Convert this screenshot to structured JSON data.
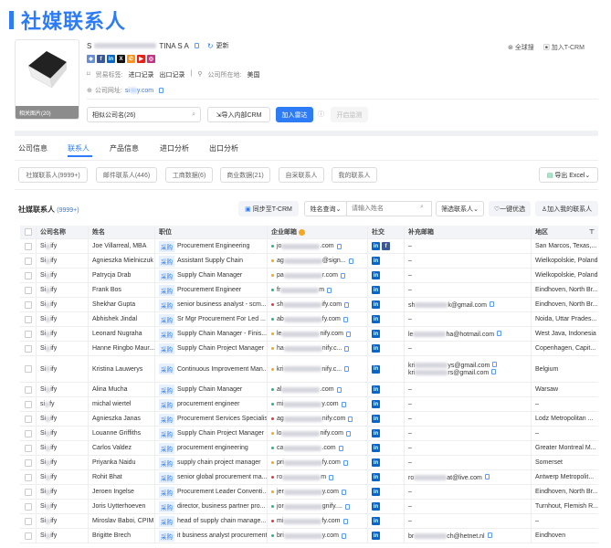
{
  "page_title": "社媒联系人",
  "company": {
    "name_prefix": "S",
    "name_suffix": "TINA S A",
    "update_label": "更新",
    "photos_label": "相关图片(20)",
    "trade_tag_label": "贸易标签:",
    "trade_tags": [
      "进口记录",
      "出口记录"
    ],
    "location_label": "公司所在地:",
    "location": "美国",
    "website_label": "公司网址:",
    "website_prefix": "si",
    "website_suffix": "y.com",
    "global_search": "全球搜",
    "add_tcrm": "加入T-CRM",
    "similar": "相似公司名(26)",
    "import_crm": "导入内部CRM",
    "add_radar": "加入雷达",
    "monitor": "开启监测"
  },
  "tabs": [
    {
      "label": "公司信息"
    },
    {
      "label": "联系人"
    },
    {
      "label": "产品信息"
    },
    {
      "label": "进口分析"
    },
    {
      "label": "出口分析"
    }
  ],
  "subtabs": [
    "社媒联系人(9999+)",
    "邮件联系人(446)",
    "工商数据(6)",
    "商业数据(21)",
    "自采联系人",
    "我的联系人"
  ],
  "export_label": "导出 Excel",
  "section": {
    "title": "社媒联系人",
    "count": "(9999+)",
    "sync": "同步至T-CRM",
    "name_query": "姓名查询",
    "search_placeholder": "请输入姓名",
    "filter": "筛选联系人",
    "optimize": "一键优选",
    "add_mine": "加入我的联系人"
  },
  "colors": {
    "accent": "#2d7cf6",
    "green": "#2bb673",
    "orange": "#f5a623",
    "red": "#e5393a"
  },
  "columns": [
    "公司名称",
    "姓名",
    "职位",
    "企业邮箱",
    "社交",
    "补充邮箱",
    "地区"
  ],
  "tag": "采购",
  "rows": [
    {
      "company": "Si ify",
      "name": "Joe Villarreal, MBA",
      "position": "Procurement Engineering",
      "ep": "jo",
      "es": ".com",
      "dot": "green",
      "fb": true,
      "supp": [],
      "region": "San Marcos, Texas,..."
    },
    {
      "company": "Si ify",
      "name": "Agnieszka Mielniczuk",
      "position": "Assistant Supply Chain",
      "ep": "ag",
      "es": "@sign...",
      "dot": "orange",
      "supp": [],
      "region": "Wielkopolskie, Poland"
    },
    {
      "company": "Si ify",
      "name": "Patrycja Drab",
      "position": "Supply Chain Manager",
      "ep": "pa",
      "es": "r.com",
      "dot": "orange",
      "supp": [],
      "region": "Wielkopolskie, Poland"
    },
    {
      "company": "Si ify",
      "name": "Frank Bos",
      "position": "Procurement Engineer",
      "ep": "fr",
      "es": "m",
      "dot": "green",
      "supp": [],
      "region": "Eindhoven, North Br..."
    },
    {
      "company": "Si ify",
      "name": "Shekhar Gupta",
      "position": "senior business analyst - scm...",
      "ep": "sh",
      "es": "ify.com",
      "dot": "red",
      "supp": [
        [
          "sh",
          "k@gmail.com"
        ]
      ],
      "region": "Eindhoven, North Br..."
    },
    {
      "company": "Si ify",
      "name": "Abhishek Jindal",
      "position": "Sr Mgr Procurement For Led ...",
      "ep": "ab",
      "es": "fy.com",
      "dot": "green",
      "supp": [],
      "region": "Noida, Uttar Prades..."
    },
    {
      "company": "Si ify",
      "name": "Leonard Nugraha",
      "position": "Supply Chain Manager - Finis...",
      "ep": "le",
      "es": "nify.com",
      "dot": "orange",
      "supp": [
        [
          "le",
          "ha@hotmail.com"
        ]
      ],
      "region": "West Java, Indonesia"
    },
    {
      "company": "Si ify",
      "name": "Hanne Ringbo Maur...",
      "position": "Supply Chain Project Manager",
      "ep": "ha",
      "es": "nify.c...",
      "dot": "orange",
      "supp": [],
      "region": "Copenhagen, Capit..."
    },
    {
      "company": "Si ify",
      "name": "Kristina Lauwerys",
      "position": "Continuous Improvement Man...",
      "ep": "kri",
      "es": "nify.c...",
      "dot": "orange",
      "supp": [
        [
          "kri",
          "ys@gmail.com"
        ],
        [
          "kri",
          "rs@gmail.com"
        ]
      ],
      "region": "Belgium"
    },
    {
      "company": "Si ify",
      "name": "Alina Mucha",
      "position": "Supply Chain Manager",
      "ep": "al",
      "es": ".com",
      "dot": "green",
      "supp": [],
      "region": "Warsaw"
    },
    {
      "company": "si fy",
      "name": "michal wiertel",
      "position": "procurement engineer",
      "ep": "mi",
      "es": "y.com",
      "dot": "green",
      "supp": [],
      "region": "–"
    },
    {
      "company": "Si ify",
      "name": "Agnieszka Janas",
      "position": "Procurement Services Specialist",
      "ep": "ag",
      "es": "nify.com",
      "dot": "red",
      "supp": [],
      "region": "Lodz Metropolitan ..."
    },
    {
      "company": "Si ify",
      "name": "Louanne Griffiths",
      "position": "Supply Chain Project Manager",
      "ep": "lo",
      "es": "nify.com",
      "dot": "orange",
      "supp": [],
      "region": "–"
    },
    {
      "company": "Si ify",
      "name": "Carlos Valdez",
      "position": "procurement engineering",
      "ep": "ca",
      "es": ".com",
      "dot": "green",
      "supp": [],
      "region": "Greater Montreal M..."
    },
    {
      "company": "Si ify",
      "name": "Priyanka Naidu",
      "position": "supply chain project manager",
      "ep": "pri",
      "es": "fy.com",
      "dot": "orange",
      "supp": [],
      "region": "Somerset"
    },
    {
      "company": "Si ify",
      "name": "Rohit Bhat",
      "position": "senior global procurement ma...",
      "ep": "ro",
      "es": "m",
      "dot": "red",
      "supp": [
        [
          "ro",
          "at@live.com"
        ]
      ],
      "region": "Antwerp Metropolit..."
    },
    {
      "company": "Si ify",
      "name": "Jeroen Ingelse",
      "position": "Procurement Leader Conventi...",
      "ep": "jer",
      "es": "y.com",
      "dot": "orange",
      "supp": [],
      "region": "Eindhoven, North Br..."
    },
    {
      "company": "Si ify",
      "name": "Joris Uytterhoeven",
      "position": "director, business partner pro...",
      "ep": "jor",
      "es": "gnify....",
      "dot": "green",
      "supp": [],
      "region": "Turnhout, Flemish R..."
    },
    {
      "company": "Si ify",
      "name": "Miroslav Baboi, CPIM",
      "position": "head of supply chain manage...",
      "ep": "mi",
      "es": "fy.com",
      "dot": "red",
      "supp": [],
      "region": "–"
    },
    {
      "company": "Si ify",
      "name": "Brigitte Brech",
      "position": "it business analyst procurement",
      "ep": "bri",
      "es": "y.com",
      "dot": "green",
      "supp": [
        [
          "br",
          "ch@hetnet.nl"
        ]
      ],
      "region": "Eindhoven"
    }
  ]
}
